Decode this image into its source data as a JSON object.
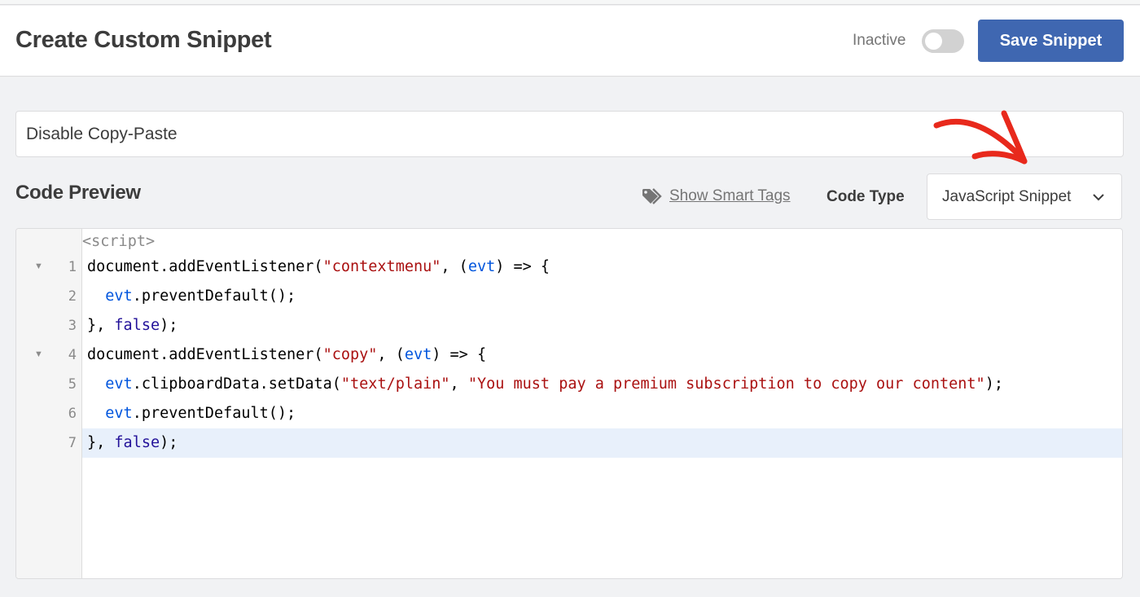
{
  "header": {
    "title": "Create Custom Snippet",
    "status_label": "Inactive",
    "toggle_active": false,
    "save_label": "Save Snippet",
    "accent_color": "#3f67b1"
  },
  "snippet": {
    "title_value": "Disable Copy-Paste",
    "title_placeholder": ""
  },
  "code_preview": {
    "section_title": "Code Preview",
    "smart_tags_label": "Show Smart Tags",
    "smart_tags_icon": "tag-icon",
    "code_type_label": "Code Type",
    "code_type_value": "JavaScript Snippet",
    "code_type_icon": "chevron-down-icon"
  },
  "editor": {
    "prefix": "<script>",
    "active_line": 7,
    "lines": [
      {
        "number": "1",
        "foldable": true,
        "tokens": [
          [
            "plain",
            "document.addEventListener("
          ],
          [
            "str",
            "\"contextmenu\""
          ],
          [
            "plain",
            ", ("
          ],
          [
            "var",
            "evt"
          ],
          [
            "plain",
            ") => {"
          ]
        ]
      },
      {
        "number": "2",
        "foldable": false,
        "tokens": [
          [
            "plain",
            "  "
          ],
          [
            "var",
            "evt"
          ],
          [
            "plain",
            ".preventDefault();"
          ]
        ]
      },
      {
        "number": "3",
        "foldable": false,
        "tokens": [
          [
            "plain",
            "}, "
          ],
          [
            "kw",
            "false"
          ],
          [
            "plain",
            ");"
          ]
        ]
      },
      {
        "number": "4",
        "foldable": true,
        "tokens": [
          [
            "plain",
            "document.addEventListener("
          ],
          [
            "str",
            "\"copy\""
          ],
          [
            "plain",
            ", ("
          ],
          [
            "var",
            "evt"
          ],
          [
            "plain",
            ") => {"
          ]
        ]
      },
      {
        "number": "5",
        "foldable": false,
        "tokens": [
          [
            "plain",
            "  "
          ],
          [
            "var",
            "evt"
          ],
          [
            "plain",
            ".clipboardData.setData("
          ],
          [
            "str",
            "\"text/plain\""
          ],
          [
            "plain",
            ", "
          ],
          [
            "str",
            "\"You must pay a premium subscription to copy our content\""
          ],
          [
            "plain",
            ");"
          ]
        ]
      },
      {
        "number": "6",
        "foldable": false,
        "tokens": [
          [
            "plain",
            "  "
          ],
          [
            "var",
            "evt"
          ],
          [
            "plain",
            ".preventDefault();"
          ]
        ]
      },
      {
        "number": "7",
        "foldable": false,
        "tokens": [
          [
            "plain",
            "}, "
          ],
          [
            "kw",
            "false"
          ],
          [
            "plain",
            ");"
          ]
        ]
      }
    ],
    "fold_glyph": "▼"
  },
  "annotation": {
    "type": "red-arrow",
    "color": "#e8291c",
    "points_to": "code-type-select"
  }
}
